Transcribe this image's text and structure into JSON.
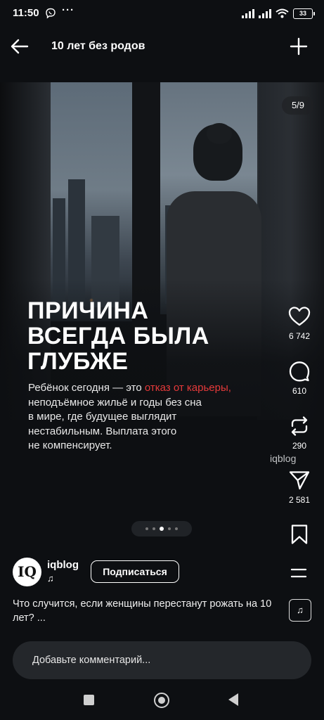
{
  "status_bar": {
    "time": "11:50",
    "extra_dots": "···",
    "battery": "33"
  },
  "header": {
    "title": "10 лет без родов"
  },
  "post": {
    "slide_counter": "5/9",
    "headline_lines": [
      "ПРИЧИНА",
      "ВСЕГДА БЫЛА",
      "ГЛУБЖЕ"
    ],
    "body": {
      "part1": "Ребёнок сегодня — это ",
      "highlight": "отказ от карьеры,",
      "line2": "неподъёмное жильё и годы без сна",
      "line3": "в мире, где будущее выглядит",
      "line4": "нестабильным. Выплата этого",
      "line5": "не компенсирует."
    },
    "watermark": "iqblog",
    "highlight_color": "#e53a3a",
    "slides_total": 5,
    "active_slide_dot": 3
  },
  "actions": {
    "likes": "6 742",
    "comments": "610",
    "reposts": "290",
    "shares": "2 581"
  },
  "author": {
    "avatar_text": "IQ",
    "name": "iqblog",
    "music_icon": "♫",
    "follow_label": "Подписаться"
  },
  "caption": "Что случится, если женщины перестанут рожать на 10 лет? ...",
  "music_button_icon": "♫",
  "comment": {
    "placeholder": "Добавьте комментарий..."
  }
}
